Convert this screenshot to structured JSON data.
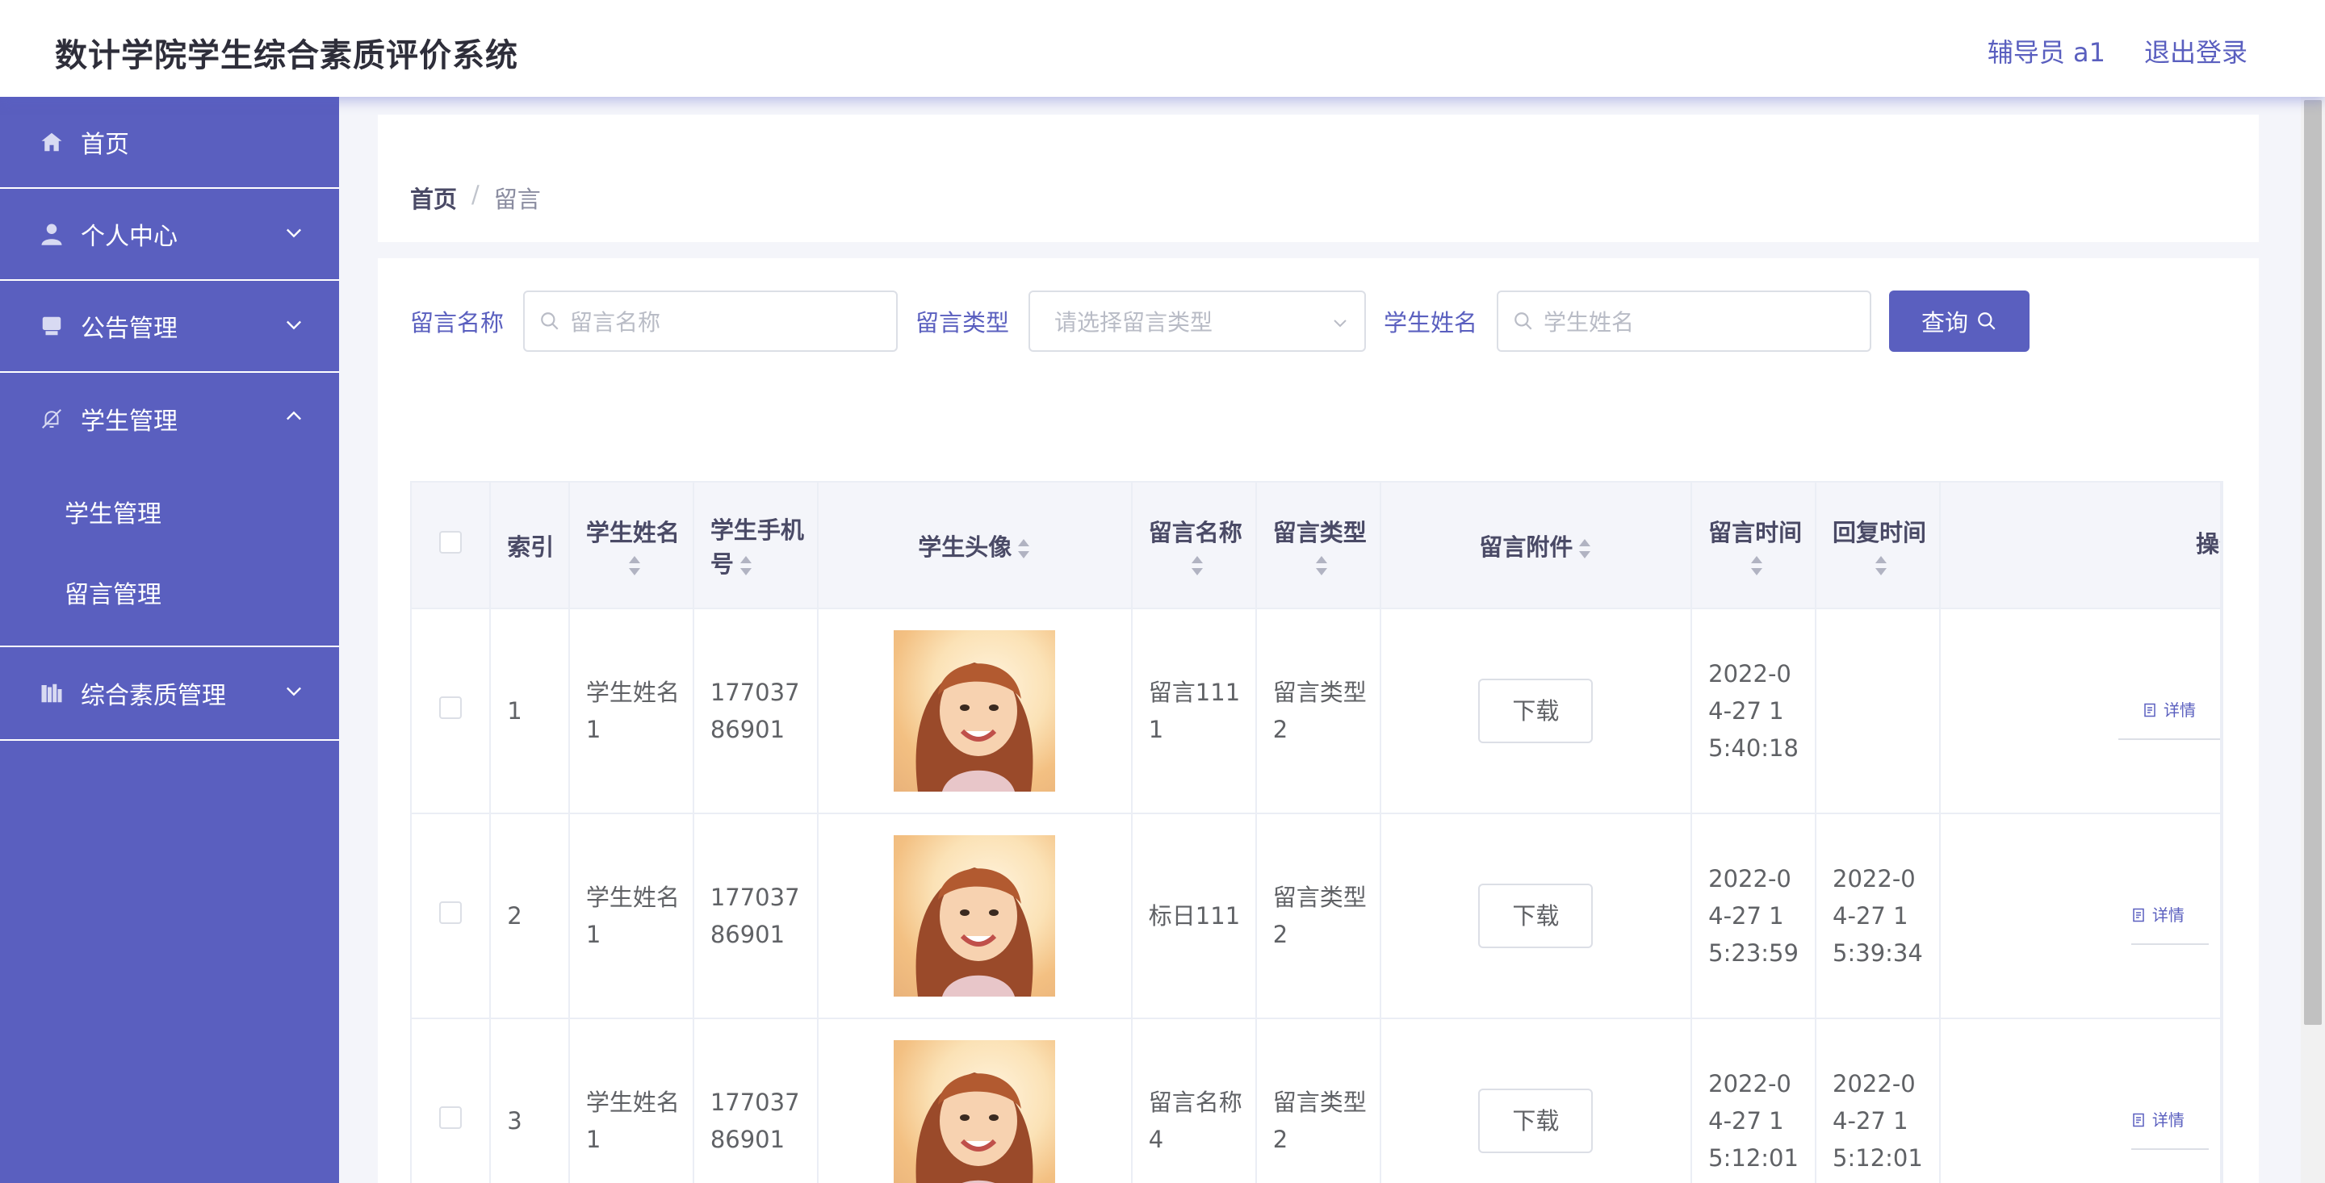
{
  "header": {
    "title": "数计学院学生综合素质评价系统",
    "user": "辅导员 a1",
    "logout": "退出登录"
  },
  "sidebar": {
    "items": [
      {
        "label": "首页",
        "icon": "home-icon"
      },
      {
        "label": "个人中心",
        "icon": "user-icon"
      },
      {
        "label": "公告管理",
        "icon": "notice-icon"
      },
      {
        "label": "学生管理",
        "icon": "bell-off-icon"
      },
      {
        "label": "综合素质管理",
        "icon": "books-icon"
      }
    ],
    "sub_items": [
      "学生管理",
      "留言管理"
    ]
  },
  "breadcrumb": {
    "home": "首页",
    "separator": "/",
    "current": "留言"
  },
  "search": {
    "name_label": "留言名称",
    "name_placeholder": "留言名称",
    "type_label": "留言类型",
    "type_placeholder": "请选择留言类型",
    "student_label": "学生姓名",
    "student_placeholder": "学生姓名",
    "query_button": "查询"
  },
  "table": {
    "columns": [
      "索引",
      "学生姓名",
      "学生手机号",
      "学生头像",
      "留言名称",
      "留言类型",
      "留言附件",
      "留言时间",
      "回复时间",
      "操作"
    ],
    "download_label": "下载",
    "detail_label": "详情",
    "rows": [
      {
        "index": "1",
        "student_name": "学生姓名1",
        "phone": "17703786901",
        "msg_name": "留言1111",
        "msg_type": "留言类型2",
        "msg_time": "2022-04-27 15:40:18",
        "reply_time": ""
      },
      {
        "index": "2",
        "student_name": "学生姓名1",
        "phone": "17703786901",
        "msg_name": "标日111",
        "msg_type": "留言类型2",
        "msg_time": "2022-04-27 15:23:59",
        "reply_time": "2022-04-27 15:39:34"
      },
      {
        "index": "3",
        "student_name": "学生姓名1",
        "phone": "17703786901",
        "msg_name": "留言名称4",
        "msg_type": "留言类型2",
        "msg_time": "2022-04-27 15:12:01",
        "reply_time": "2022-04-27 15:12:01"
      }
    ]
  },
  "colors": {
    "primary": "#5a5fbf",
    "header_text": "#2e2e3a",
    "table_header_bg": "#f4f5fa"
  }
}
